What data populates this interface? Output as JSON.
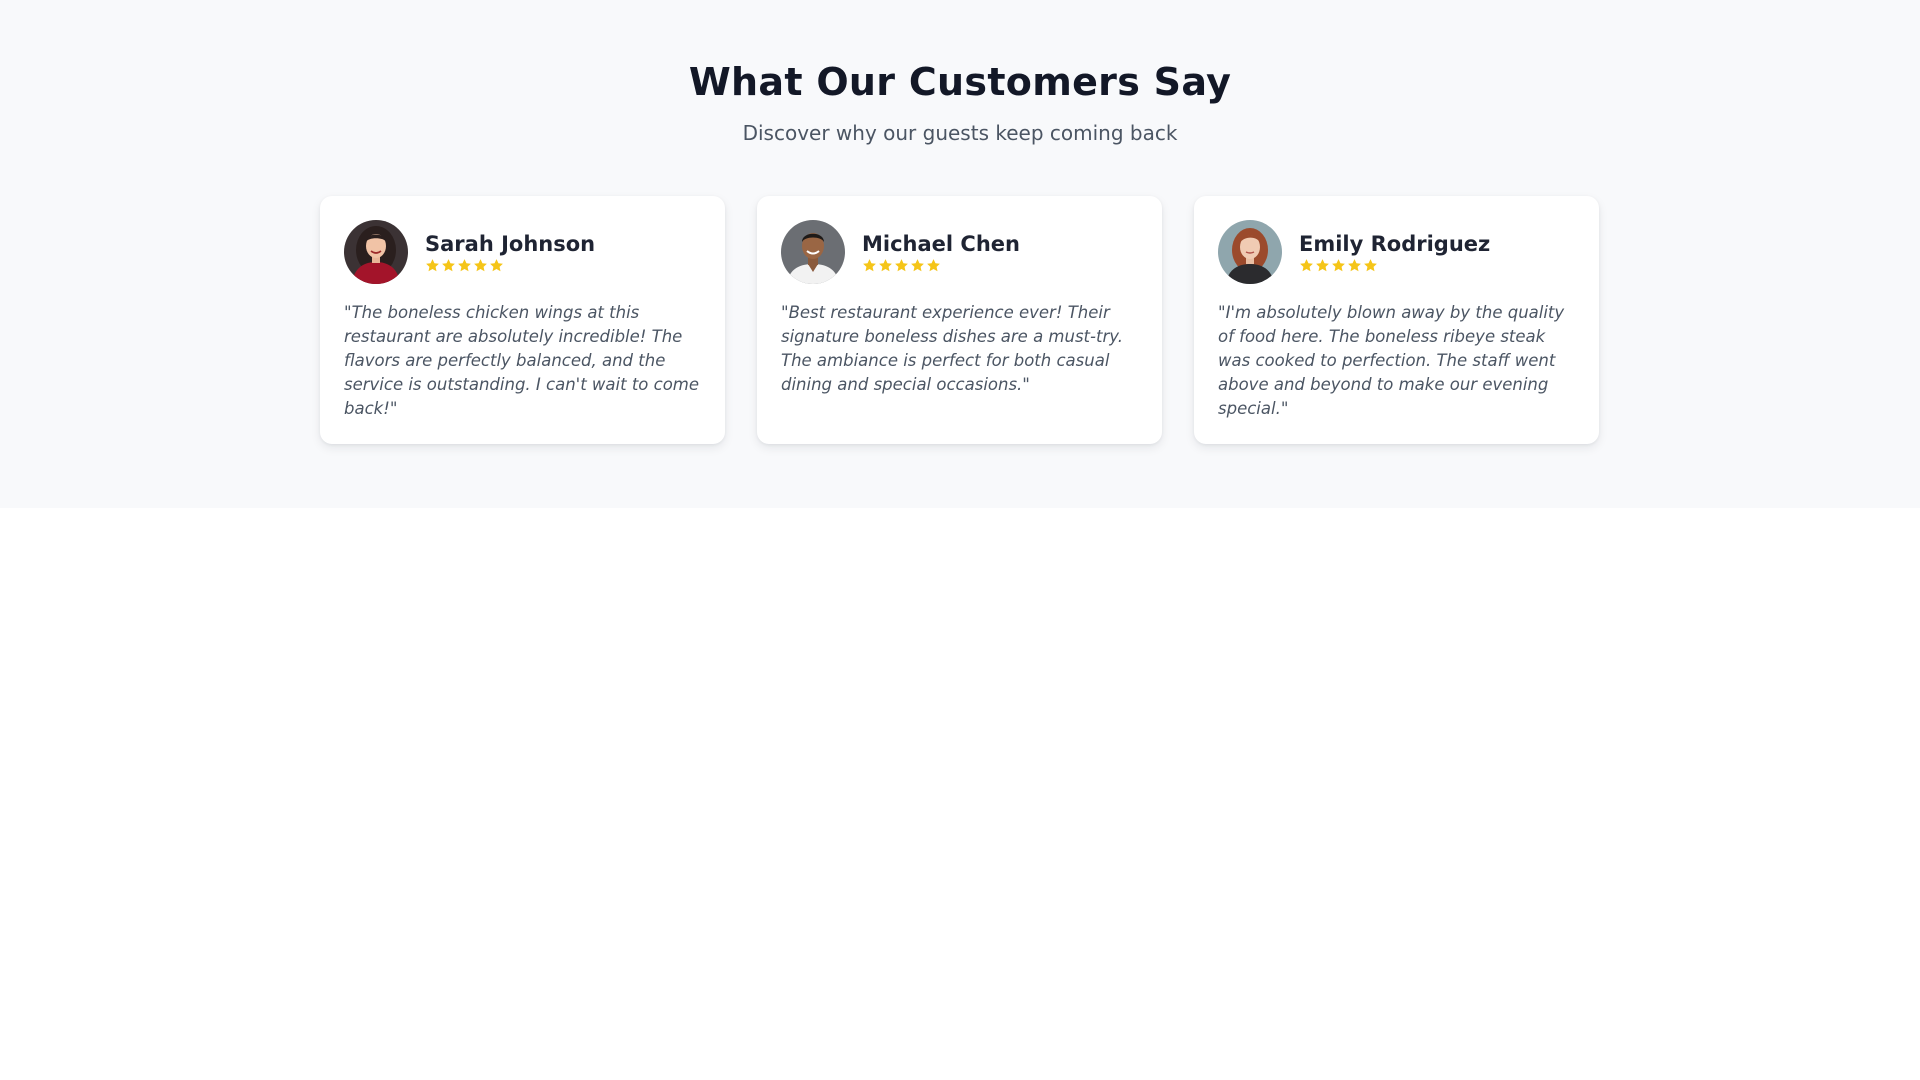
{
  "section": {
    "title": "What Our Customers Say",
    "subtitle": "Discover why our guests keep coming back"
  },
  "colors": {
    "star": "#f5c518",
    "heading": "#131827",
    "text_muted": "#4b5563",
    "background": "#f8f9fb"
  },
  "testimonials": [
    {
      "name": "Sarah Johnson",
      "rating": 5,
      "rating_max": 5,
      "avatar_icon": "avatar-woman-red-dress",
      "quote": "\"The boneless chicken wings at this restaurant are absolutely incredible! The flavors are perfectly balanced, and the service is outstanding. I can't wait to come back!\""
    },
    {
      "name": "Michael Chen",
      "rating": 5,
      "rating_max": 5,
      "avatar_icon": "avatar-man-white-shirt",
      "quote": "\"Best restaurant experience ever! Their signature boneless dishes are a must-try. The ambiance is perfect for both casual dining and special occasions.\""
    },
    {
      "name": "Emily Rodriguez",
      "rating": 5,
      "rating_max": 5,
      "avatar_icon": "avatar-woman-red-hair",
      "quote": "\"I'm absolutely blown away by the quality of food here. The boneless ribeye steak was cooked to perfection. The staff went above and beyond to make our evening special.\""
    }
  ]
}
